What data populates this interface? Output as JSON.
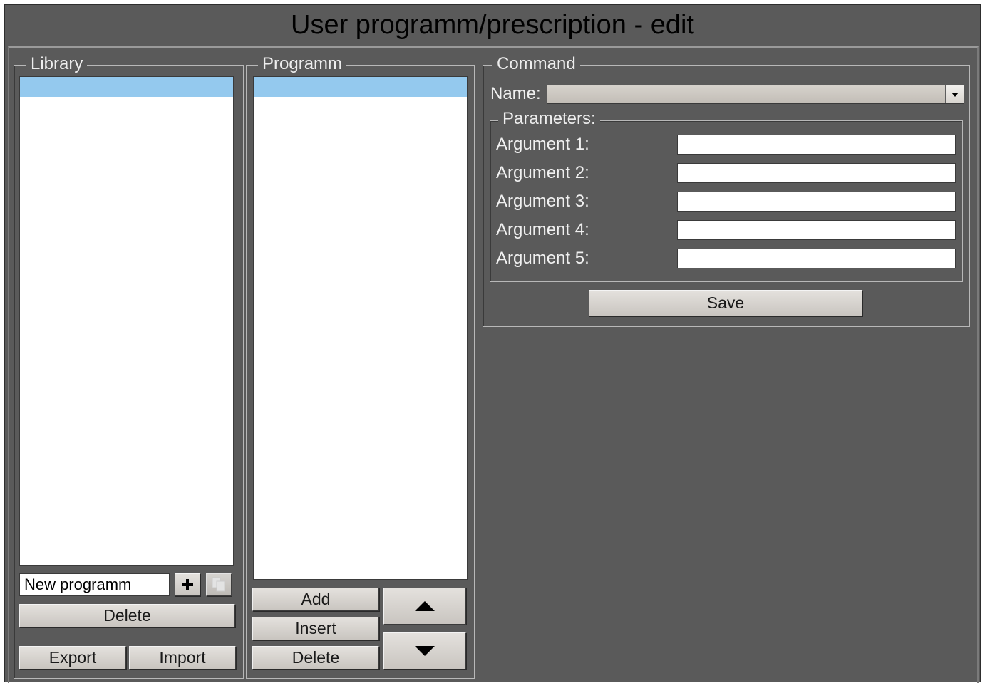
{
  "window": {
    "title": "User programm/prescription - edit"
  },
  "library": {
    "legend": "Library",
    "new_name_value": "New programm",
    "delete_label": "Delete",
    "export_label": "Export",
    "import_label": "Import"
  },
  "programm": {
    "legend": "Programm",
    "add_label": "Add",
    "insert_label": "Insert",
    "delete_label": "Delete"
  },
  "command": {
    "legend": "Command",
    "name_label": "Name:",
    "name_value": "",
    "parameters_legend": "Parameters:",
    "arguments": [
      {
        "label": "Argument 1:",
        "value": ""
      },
      {
        "label": "Argument 2:",
        "value": ""
      },
      {
        "label": "Argument 3:",
        "value": ""
      },
      {
        "label": "Argument 4:",
        "value": ""
      },
      {
        "label": "Argument 5:",
        "value": ""
      }
    ],
    "save_label": "Save"
  },
  "icons": {
    "add_program": "plus-icon",
    "copy_program": "copy-icon",
    "move_up": "triangle-up-icon",
    "move_down": "triangle-down-icon",
    "dropdown": "chevron-down-icon"
  },
  "colors": {
    "background": "#5a5a5a",
    "selection": "#94c9ee",
    "button": "#d6d2cc"
  }
}
